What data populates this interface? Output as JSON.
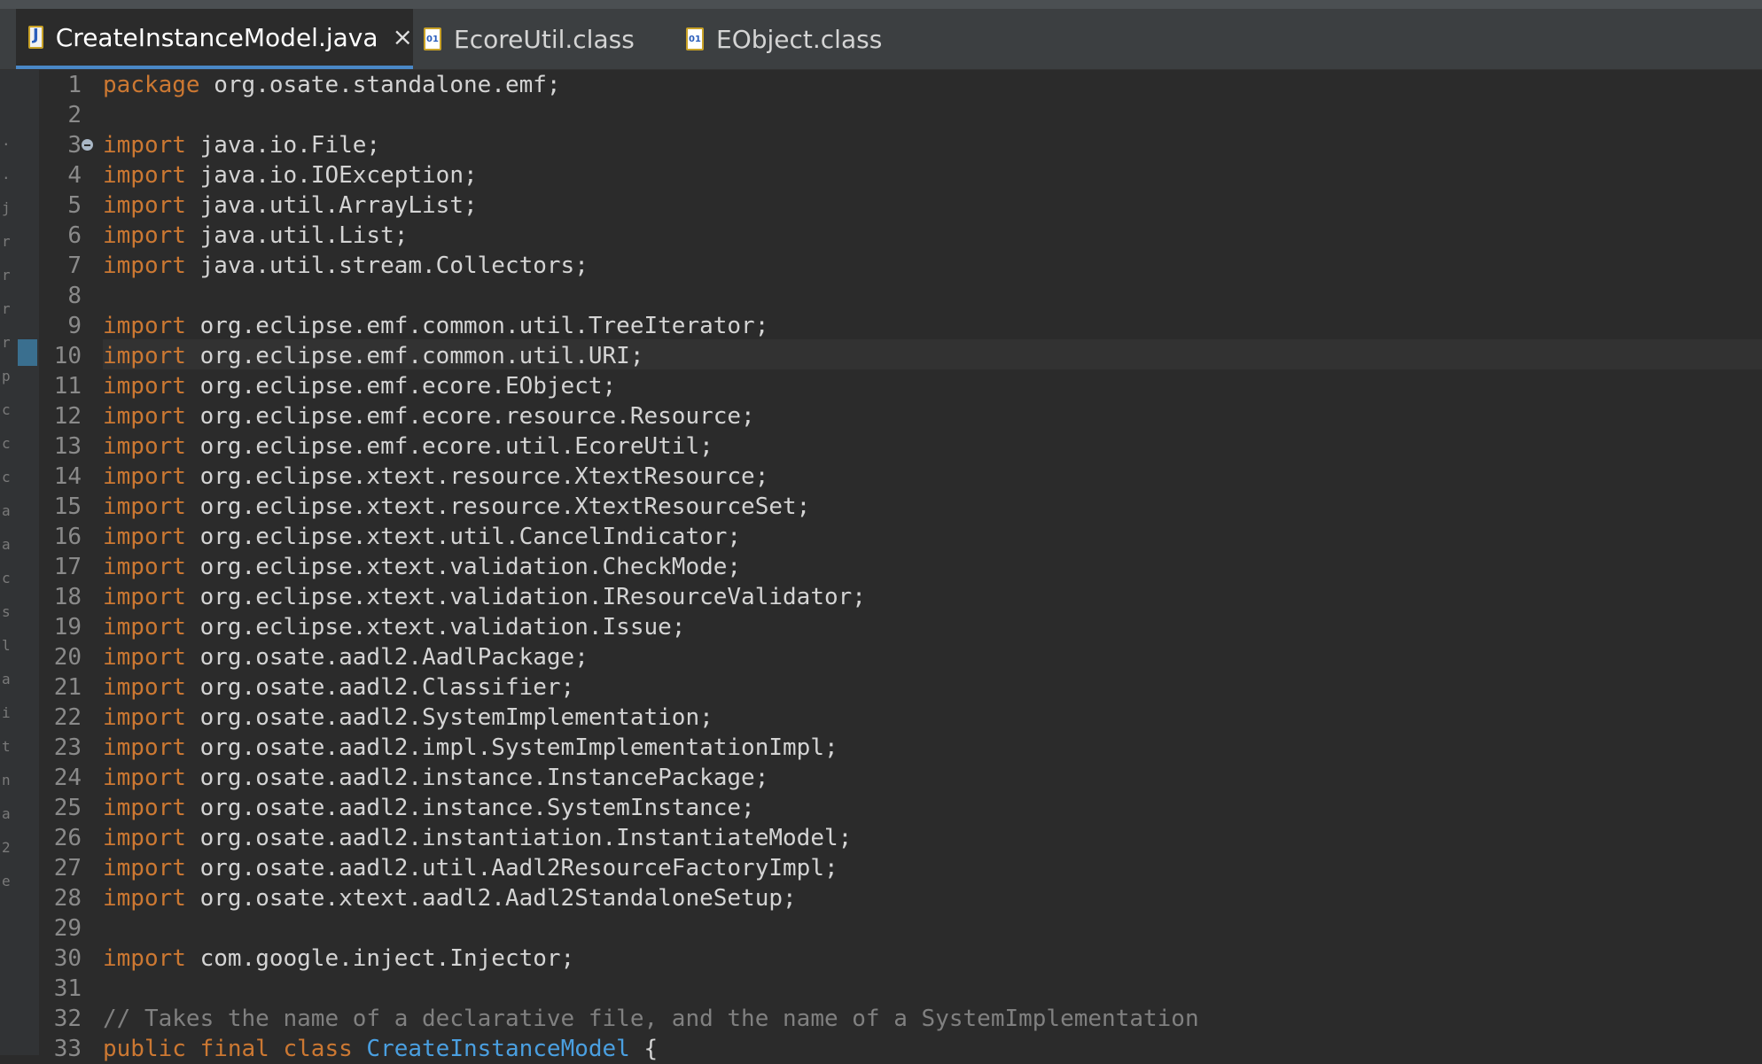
{
  "tabs": [
    {
      "label": "CreateInstanceModel.java",
      "icon": "java-file-icon",
      "active": true,
      "closable": true
    },
    {
      "label": "EcoreUtil.class",
      "icon": "class-file-icon",
      "active": false,
      "closable": false
    },
    {
      "label": "EObject.class",
      "icon": "class-file-icon",
      "active": false,
      "closable": false
    }
  ],
  "colors": {
    "background": "#2b2b2b",
    "keyword": "#cc7832",
    "comment": "#808080",
    "class_name": "#4a9fe0",
    "text": "#d4d4d4",
    "line_number": "#8a8a8a",
    "active_tab_accent": "#4a88c7"
  },
  "left_margin_glyphs": [
    ".",
    ".",
    "j",
    "r",
    "r",
    "r",
    "r",
    "p",
    "c",
    "c",
    "c",
    "a",
    "a",
    "c",
    "s",
    "l",
    "a",
    "i",
    "t",
    "n",
    "a",
    "2",
    "e"
  ],
  "editor": {
    "current_line": 10,
    "lines": [
      {
        "n": "1",
        "kw": "package",
        "rest": " org.osate.standalone.emf;"
      },
      {
        "n": "2"
      },
      {
        "n": "3",
        "kw": "import",
        "rest": " java.io.File;",
        "fold": true
      },
      {
        "n": "4",
        "kw": "import",
        "rest": " java.io.IOException;"
      },
      {
        "n": "5",
        "kw": "import",
        "rest": " java.util.ArrayList;"
      },
      {
        "n": "6",
        "kw": "import",
        "rest": " java.util.List;"
      },
      {
        "n": "7",
        "kw": "import",
        "rest": " java.util.stream.Collectors;"
      },
      {
        "n": "8"
      },
      {
        "n": "9",
        "kw": "import",
        "rest": " org.eclipse.emf.common.util.TreeIterator;"
      },
      {
        "n": "10",
        "kw": "import",
        "rest": " org.eclipse.emf.common.util.URI;"
      },
      {
        "n": "11",
        "kw": "import",
        "rest": " org.eclipse.emf.ecore.EObject;"
      },
      {
        "n": "12",
        "kw": "import",
        "rest": " org.eclipse.emf.ecore.resource.Resource;"
      },
      {
        "n": "13",
        "kw": "import",
        "rest": " org.eclipse.emf.ecore.util.EcoreUtil;"
      },
      {
        "n": "14",
        "kw": "import",
        "rest": " org.eclipse.xtext.resource.XtextResource;"
      },
      {
        "n": "15",
        "kw": "import",
        "rest": " org.eclipse.xtext.resource.XtextResourceSet;"
      },
      {
        "n": "16",
        "kw": "import",
        "rest": " org.eclipse.xtext.util.CancelIndicator;"
      },
      {
        "n": "17",
        "kw": "import",
        "rest": " org.eclipse.xtext.validation.CheckMode;"
      },
      {
        "n": "18",
        "kw": "import",
        "rest": " org.eclipse.xtext.validation.IResourceValidator;"
      },
      {
        "n": "19",
        "kw": "import",
        "rest": " org.eclipse.xtext.validation.Issue;"
      },
      {
        "n": "20",
        "kw": "import",
        "rest": " org.osate.aadl2.AadlPackage;"
      },
      {
        "n": "21",
        "kw": "import",
        "rest": " org.osate.aadl2.Classifier;"
      },
      {
        "n": "22",
        "kw": "import",
        "rest": " org.osate.aadl2.SystemImplementation;"
      },
      {
        "n": "23",
        "kw": "import",
        "rest": " org.osate.aadl2.impl.SystemImplementationImpl;"
      },
      {
        "n": "24",
        "kw": "import",
        "rest": " org.osate.aadl2.instance.InstancePackage;"
      },
      {
        "n": "25",
        "kw": "import",
        "rest": " org.osate.aadl2.instance.SystemInstance;"
      },
      {
        "n": "26",
        "kw": "import",
        "rest": " org.osate.aadl2.instantiation.InstantiateModel;"
      },
      {
        "n": "27",
        "kw": "import",
        "rest": " org.osate.aadl2.util.Aadl2ResourceFactoryImpl;"
      },
      {
        "n": "28",
        "kw": "import",
        "rest": " org.osate.xtext.aadl2.Aadl2StandaloneSetup;"
      },
      {
        "n": "29"
      },
      {
        "n": "30",
        "kw": "import",
        "rest": " com.google.inject.Injector;"
      },
      {
        "n": "31"
      },
      {
        "n": "32",
        "comment": "// Takes the name of a declarative file, and the name of a SystemImplementation"
      },
      {
        "n": "33",
        "kw": "public final class",
        "cls": " CreateInstanceModel",
        "rest": " {"
      }
    ]
  }
}
